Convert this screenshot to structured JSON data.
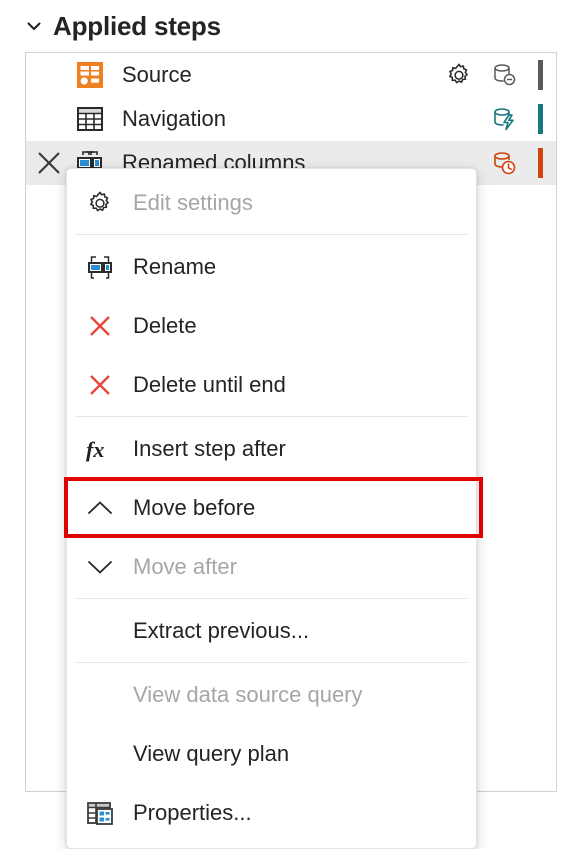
{
  "header": {
    "chevron_icon": "chevron-down-icon",
    "title": "Applied steps"
  },
  "steps": [
    {
      "label": "Source",
      "icon": "source-icon",
      "has_delete": false,
      "selected": false,
      "gear": true,
      "gear_icon": "gear-icon",
      "db_icon": "database-minus-icon",
      "db_color": "#5a5a5a",
      "status_color": "#5a5a5a"
    },
    {
      "label": "Navigation",
      "icon": "table-icon",
      "has_delete": false,
      "selected": false,
      "gear": false,
      "gear_icon": "gear-icon",
      "db_icon": "database-lightning-icon",
      "db_color": "#13787f",
      "status_color": "#13787f"
    },
    {
      "label": "Renamed columns",
      "icon": "rename-columns-icon",
      "has_delete": true,
      "delete_icon": "close-icon",
      "selected": true,
      "gear": false,
      "gear_icon": "gear-icon",
      "db_icon": "database-clock-icon",
      "db_color": "#d0430f",
      "status_color": "#d0430f"
    }
  ],
  "context_menu": {
    "items": [
      {
        "label": "Edit settings",
        "icon": "gear-icon",
        "disabled": true,
        "highlighted": false,
        "separator_after": true
      },
      {
        "label": "Rename",
        "icon": "rename-icon",
        "disabled": false,
        "highlighted": false,
        "separator_after": false
      },
      {
        "label": "Delete",
        "icon": "delete-x-icon",
        "disabled": false,
        "highlighted": false,
        "separator_after": false
      },
      {
        "label": "Delete until end",
        "icon": "delete-x-icon",
        "disabled": false,
        "highlighted": false,
        "separator_after": true
      },
      {
        "label": "Insert step after",
        "icon": "fx-icon",
        "disabled": false,
        "highlighted": false,
        "separator_after": false
      },
      {
        "label": "Move before",
        "icon": "chevron-up-icon",
        "disabled": false,
        "highlighted": true,
        "separator_after": false
      },
      {
        "label": "Move after",
        "icon": "chevron-down-icon",
        "disabled": true,
        "highlighted": false,
        "separator_after": true
      },
      {
        "label": "Extract previous...",
        "icon": "none",
        "disabled": false,
        "highlighted": false,
        "separator_after": true
      },
      {
        "label": "View data source query",
        "icon": "none",
        "disabled": true,
        "highlighted": false,
        "separator_after": false
      },
      {
        "label": "View query plan",
        "icon": "none",
        "disabled": false,
        "highlighted": false,
        "separator_after": false
      },
      {
        "label": "Properties...",
        "icon": "properties-icon",
        "disabled": false,
        "highlighted": false,
        "separator_after": false
      }
    ]
  },
  "colors": {
    "highlight_box": "#e00000",
    "source_orange": "#ee8022",
    "accent_blue": "#2a8fd4",
    "selected_row": "#ebebeb",
    "text": "#242424",
    "disabled_text": "#a6a6a6"
  }
}
